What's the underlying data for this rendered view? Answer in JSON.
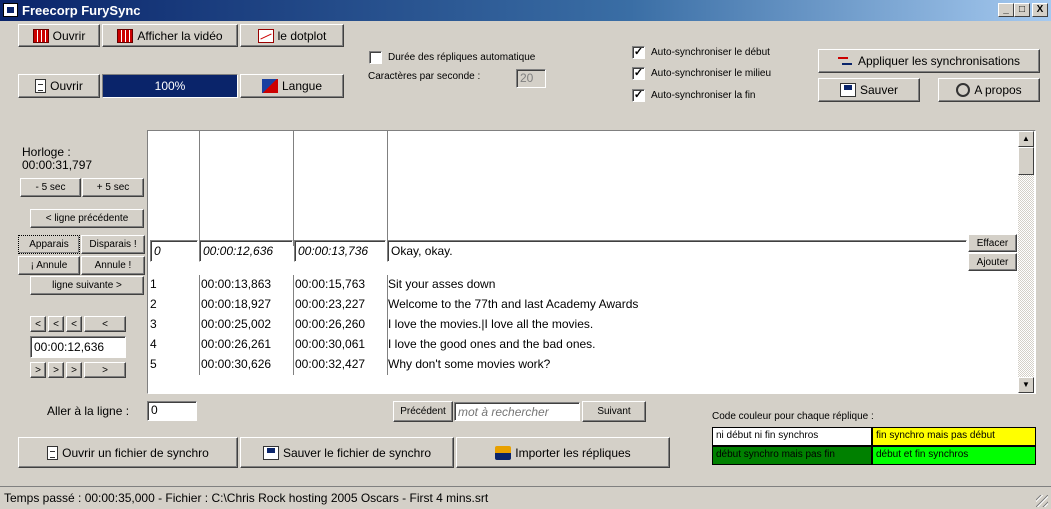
{
  "window": {
    "title": "Freecorp FurySync",
    "minimize": "_",
    "maximize": "□",
    "close": "X"
  },
  "toolbar": {
    "ouvrir1": "Ouvrir",
    "afficher_video": "Afficher la vidéo",
    "dotplot": "le dotplot",
    "ouvrir2": "Ouvrir",
    "progress": "100%",
    "langue": "Langue",
    "duree_auto": "Durée des répliques automatique",
    "duree_checked": false,
    "cps_label": "Caractères par seconde :",
    "cps_value": "20",
    "sync_debut": "Auto-synchroniser le début",
    "sync_milieu": "Auto-synchroniser le milieu",
    "sync_fin": "Auto-synchroniser la fin",
    "appliquer": "Appliquer les synchronisations",
    "sauver": "Sauver",
    "apropos": "A propos"
  },
  "left": {
    "horloge_label": "Horloge :",
    "horloge_value": "00:00:31,797",
    "minus5": "- 5 sec",
    "plus5": "+ 5 sec",
    "ligne_prec": "< ligne précédente",
    "apparais": "Apparais",
    "disparais": "Disparais !",
    "annule1": "¡ Annule",
    "annule2": "Annule !",
    "ligne_suiv": "ligne suivante >",
    "nav_left": "<",
    "nav_right": ">",
    "time_value": "00:00:12,636"
  },
  "editor": {
    "num": "0",
    "start": "00:00:12,636",
    "end": "00:00:13,736",
    "text": "Okay, okay.",
    "effacer": "Effacer",
    "ajouter": "Ajouter"
  },
  "rows": [
    {
      "n": "1",
      "start": "00:00:13,863",
      "end": "00:00:15,763",
      "text": "Sit your asses down"
    },
    {
      "n": "2",
      "start": "00:00:18,927",
      "end": "00:00:23,227",
      "text": "Welcome to the 77th and last Academy Awards"
    },
    {
      "n": "3",
      "start": "00:00:25,002",
      "end": "00:00:26,260",
      "text": "I love the movies.|I love all the movies."
    },
    {
      "n": "4",
      "start": "00:00:26,261",
      "end": "00:00:30,061",
      "text": "I love the good ones and the bad ones."
    },
    {
      "n": "5",
      "start": "00:00:30,626",
      "end": "00:00:32,427",
      "text": "Why don't some movies work?"
    }
  ],
  "bottom": {
    "aller_label": "Aller à la ligne :",
    "aller_value": "0",
    "precedent": "Précédent",
    "search_placeholder": "mot à rechercher",
    "suivant": "Suivant",
    "ouvrir_synchro": "Ouvrir un fichier de synchro",
    "sauver_synchro": "Sauver le fichier de synchro",
    "importer": "Importer les répliques"
  },
  "legend": {
    "title": "Code couleur pour chaque réplique :",
    "none": "ni début ni fin synchros",
    "fin_only": "fin synchro mais pas début",
    "debut_only": "début synchro mais pas fin",
    "both": "début et fin synchros",
    "colors": {
      "none": "#ffffff",
      "fin_only": "#ffff00",
      "debut_only": "#008000",
      "both": "#00ff00"
    }
  },
  "status": "Temps passé : 00:00:35,000 - Fichier : C:\\Chris Rock hosting 2005 Oscars - First 4 mins.srt"
}
